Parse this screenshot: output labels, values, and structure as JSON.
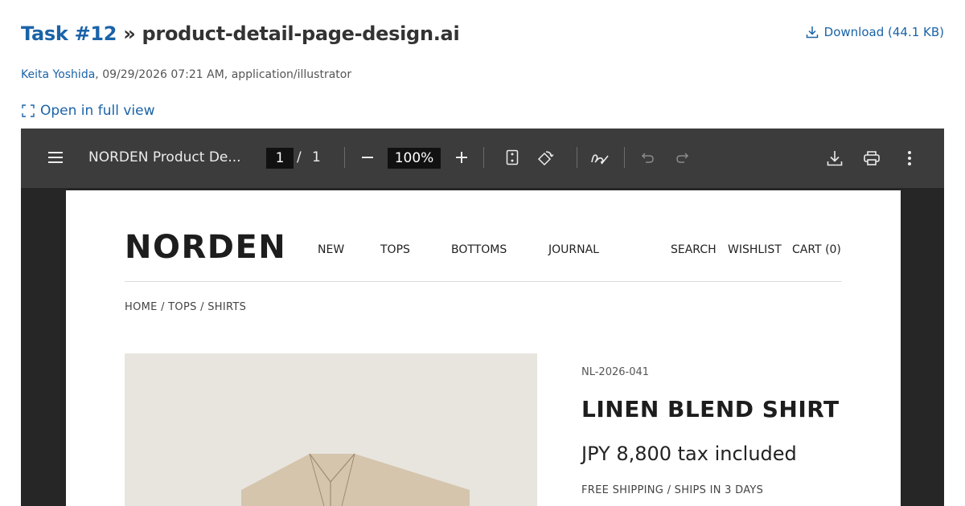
{
  "header": {
    "task_label": "Task #12",
    "separator": "»",
    "file_name": "product-detail-page-design.ai",
    "download_label": "Download (44.1 KB)"
  },
  "meta": {
    "author": "Keita Yoshida",
    "details": ", 09/29/2026 07:21 AM, application/illustrator"
  },
  "open_full_label": "Open in full view",
  "viewer": {
    "document_title": "NORDEN Product De...",
    "current_page": "1",
    "page_separator": "/",
    "total_pages": "1",
    "zoom": "100%",
    "icons": [
      "menu-icon",
      "zoom-out-icon",
      "zoom-in-icon",
      "fit-page-icon",
      "rotate-icon",
      "annotate-icon",
      "undo-icon",
      "redo-icon",
      "download-icon",
      "print-icon",
      "more-icon"
    ]
  },
  "document": {
    "brand": "NORDEN",
    "nav": [
      "NEW",
      "TOPS",
      "BOTTOMS",
      "JOURNAL"
    ],
    "nav_right": [
      "SEARCH",
      "WISHLIST",
      "CART (0)"
    ],
    "breadcrumb": "HOME / TOPS / SHIRTS",
    "sku": "NL-2026-041",
    "product_name": "LINEN BLEND SHIRT",
    "price": "JPY 8,800  tax included",
    "shipping": "FREE SHIPPING / SHIPS IN 3 DAYS"
  },
  "colors": {
    "link": "#1a63a8",
    "toolbar": "#3c3c3c",
    "viewer_bg": "#262626",
    "image_bg": "#e8e5de",
    "shirt": "#d5c5ad"
  }
}
